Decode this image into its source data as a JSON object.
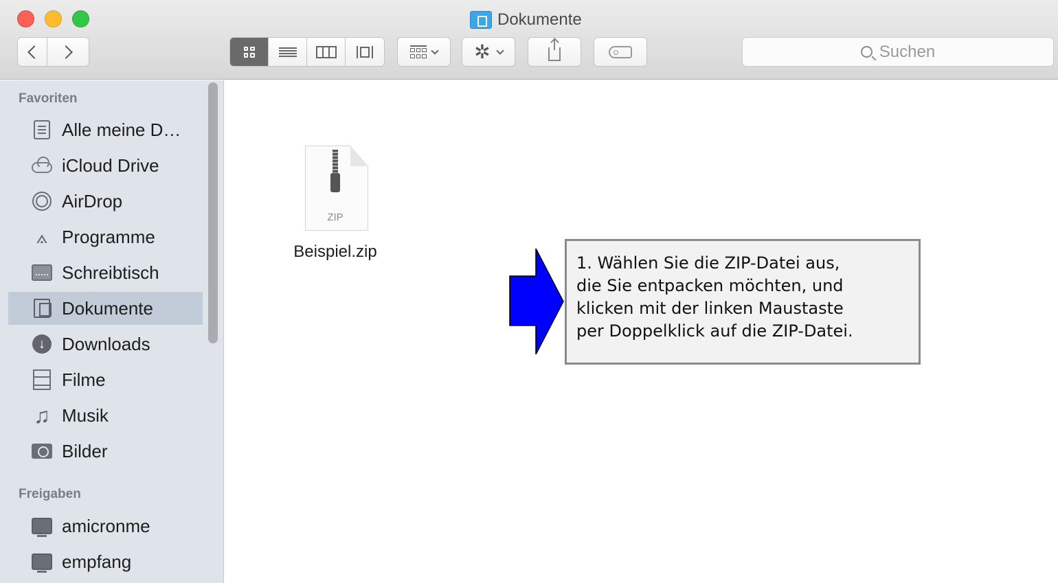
{
  "window": {
    "title": "Dokumente"
  },
  "toolbar": {
    "search_placeholder": "Suchen"
  },
  "sidebar": {
    "favorites_header": "Favoriten",
    "shares_header": "Freigaben",
    "favorites": [
      {
        "label": "Alle meine D…",
        "icon": "all-documents-icon"
      },
      {
        "label": "iCloud Drive",
        "icon": "cloud-icon"
      },
      {
        "label": "AirDrop",
        "icon": "airdrop-icon"
      },
      {
        "label": "Programme",
        "icon": "applications-icon"
      },
      {
        "label": "Schreibtisch",
        "icon": "desktop-icon"
      },
      {
        "label": "Dokumente",
        "icon": "documents-icon",
        "selected": true
      },
      {
        "label": "Downloads",
        "icon": "download-icon"
      },
      {
        "label": "Filme",
        "icon": "film-icon"
      },
      {
        "label": "Musik",
        "icon": "music-icon"
      },
      {
        "label": "Bilder",
        "icon": "camera-icon"
      }
    ],
    "shares": [
      {
        "label": "amicronme",
        "icon": "monitor-icon"
      },
      {
        "label": "empfang",
        "icon": "monitor-icon"
      }
    ]
  },
  "main": {
    "file": {
      "name": "Beispiel.zip",
      "type_label": "ZIP"
    }
  },
  "callout": {
    "lines": [
      "1. Wählen Sie die ZIP-Datei aus,",
      "die Sie entpacken möchten, und",
      "klicken mit der linken Maustaste",
      "per Doppelklick auf die ZIP-Datei."
    ],
    "arrow_color": "#0000ff"
  },
  "colors": {
    "sidebar_bg": "#dfe3ea",
    "selection": "#c2cbd8",
    "close": "#fc5f57",
    "minimize": "#fdbc2e",
    "zoom": "#33c748"
  }
}
